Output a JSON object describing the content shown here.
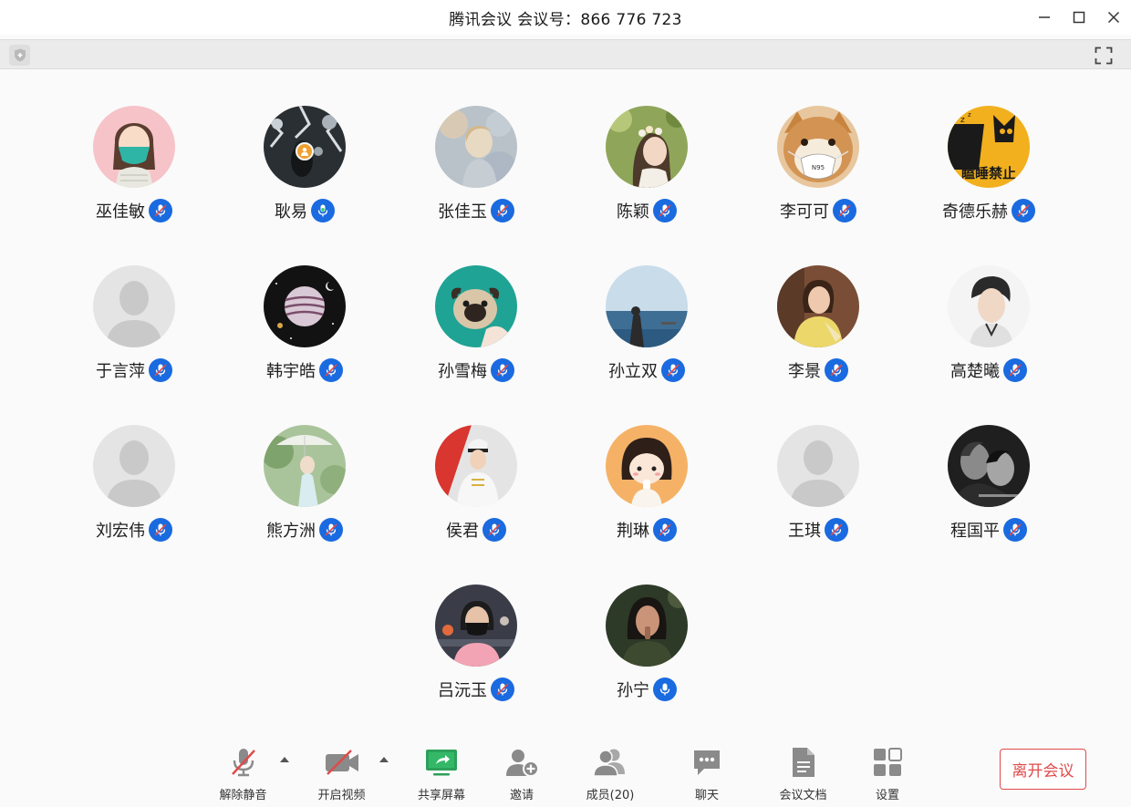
{
  "window": {
    "title": "腾讯会议 会议号：866 776 723"
  },
  "colors": {
    "accent_blue": "#1a6ae0",
    "share_green": "#2ca05a",
    "leave_red": "#e04a4a",
    "host_orange": "#f0a030"
  },
  "participants": [
    {
      "name": "巫佳敏",
      "mic": "muted",
      "avatar": "girl-mask-illustration"
    },
    {
      "name": "耿易",
      "mic": "on",
      "avatar": "photo-snow-trees",
      "host": true
    },
    {
      "name": "张佳玉",
      "mic": "muted",
      "avatar": "photo-painting"
    },
    {
      "name": "陈颖",
      "mic": "muted",
      "avatar": "photo-girl-flowers"
    },
    {
      "name": "李可可",
      "mic": "muted",
      "avatar": "shiba-dog-mask"
    },
    {
      "name": "奇德乐赫",
      "mic": "muted",
      "avatar": "cartoon-sleeping-forbidden"
    },
    {
      "name": "于言萍",
      "mic": "muted",
      "avatar": "default-silhouette"
    },
    {
      "name": "韩宇皓",
      "mic": "muted",
      "avatar": "planet-illustration"
    },
    {
      "name": "孙雪梅",
      "mic": "muted",
      "avatar": "pug-dog"
    },
    {
      "name": "孙立双",
      "mic": "muted",
      "avatar": "photo-sea"
    },
    {
      "name": "李景",
      "mic": "muted",
      "avatar": "photo-woman-yellow"
    },
    {
      "name": "高楚曦",
      "mic": "muted",
      "avatar": "photo-man-portrait"
    },
    {
      "name": "刘宏伟",
      "mic": "muted",
      "avatar": "default-silhouette"
    },
    {
      "name": "熊方洲",
      "mic": "muted",
      "avatar": "photo-girl-umbrella"
    },
    {
      "name": "侯君",
      "mic": "muted",
      "avatar": "photo-uniform"
    },
    {
      "name": "荆琳",
      "mic": "muted",
      "avatar": "cartoon-girl"
    },
    {
      "name": "王琪",
      "mic": "muted",
      "avatar": "default-silhouette"
    },
    {
      "name": "程国平",
      "mic": "muted",
      "avatar": "photo-movie-bw"
    },
    {
      "name": "吕沅玉",
      "mic": "muted",
      "avatar": "photo-woman-mask"
    },
    {
      "name": "孙宁",
      "mic": "on",
      "avatar": "photo-woman-dark"
    }
  ],
  "avatar_texts": {
    "sleeping_sign": "瞌睡禁止",
    "mask_label": "N95"
  },
  "toolbar": {
    "unmute_label": "解除静音",
    "video_label": "开启视频",
    "share_label": "共享屏幕",
    "invite_label": "邀请",
    "members_label": "成员(20)",
    "chat_label": "聊天",
    "docs_label": "会议文档",
    "settings_label": "设置",
    "leave_label": "离开会议"
  }
}
